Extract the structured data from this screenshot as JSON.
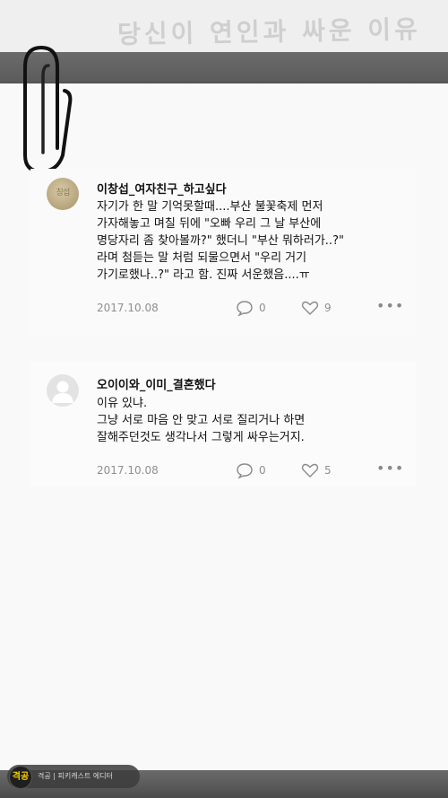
{
  "header": {
    "title": "당신이 연인과 싸운 이유"
  },
  "comments": [
    {
      "username": "이창섭_여자친구_하고싶다",
      "avatar_stamp": "창섭",
      "lines": [
        "자기가 한 말 기억못할때....부산 불꽃축제 먼저",
        "가자해놓고 며칠 뒤에 \"오빠 우리 그 날 부산에",
        "명당자리 좀 찾아볼까?\" 했더니 \"부산 뭐하러가..?\"",
        "라며 첨듣는 말 처럼 되물으면서 \"우리 거기",
        "가기로했나..?\" 라고 함. 진짜 서운했음....ㅠ"
      ],
      "date": "2017.10.08",
      "reply_count": "0",
      "like_count": "9",
      "more": "•••"
    },
    {
      "username": "오이이와_이미_결혼했다",
      "lines": [
        "이유 있냐.",
        "그냥 서로 마음 안 맞고 서로 질리거나 하면",
        "잘해주던것도 생각나서 그렇게 싸우는거지."
      ],
      "date": "2017.10.08",
      "reply_count": "0",
      "like_count": "5",
      "more": "•••"
    }
  ],
  "footer": {
    "logo_text": "격공",
    "caption": "격공 | 피키캐스트 에디터"
  }
}
